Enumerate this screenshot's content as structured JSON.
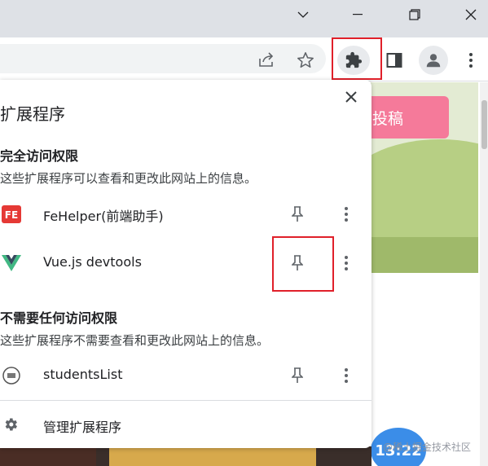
{
  "window_controls": {
    "dropdown_icon": "chevron-down-icon",
    "minimize_icon": "minimize-icon",
    "restore_icon": "restore-icon",
    "close_icon": "close-icon"
  },
  "toolbar": {
    "share_icon": "share-icon",
    "bookmark_icon": "star-icon",
    "extensions_icon": "puzzle-icon",
    "sidepanel_icon": "side-panel-icon",
    "profile_icon": "profile-icon",
    "menu_icon": "more-vert-icon"
  },
  "popup": {
    "title": "扩展程序",
    "full_access": {
      "heading": "完全访问权限",
      "description": "这些扩展程序可以查看和更改此网站上的信息。",
      "items": [
        {
          "name": "FeHelper(前端助手)",
          "logo_text": "FE",
          "logo_color": "#e53935"
        },
        {
          "name": "Vue.js devtools",
          "logo_color": "#41b883"
        }
      ]
    },
    "no_access": {
      "heading": "不需要任何访问权限",
      "description": "这些扩展程序不需要查看和更改此网站上的信息。",
      "items": [
        {
          "name": "studentsList"
        }
      ]
    },
    "manage_label": "管理扩展程序"
  },
  "page": {
    "button_label": "投稿",
    "timer": "13:22",
    "watermark": "@稀土掘金技术社区"
  },
  "colors": {
    "highlight": "#e0202a",
    "accent_pink": "#f57a9a",
    "timer_blue": "#3b8de8"
  }
}
